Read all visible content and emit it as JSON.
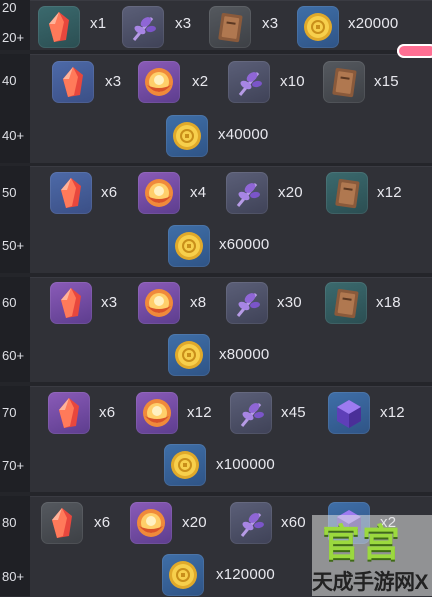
{
  "levels": [
    "20",
    "20+",
    "40",
    "40+",
    "50",
    "50+",
    "60",
    "60+",
    "70",
    "70+",
    "80",
    "80+"
  ],
  "rows": [
    {
      "rewards": [
        "x1",
        "x3",
        "x3",
        "x20000"
      ]
    },
    {
      "rewards": [
        "x3",
        "x2",
        "x10",
        "x15"
      ],
      "gold": "x40000"
    },
    {
      "rewards": [
        "x6",
        "x4",
        "x20",
        "x12"
      ],
      "gold": "x60000"
    },
    {
      "rewards": [
        "x3",
        "x8",
        "x30",
        "x18"
      ],
      "gold": "x80000"
    },
    {
      "rewards": [
        "x6",
        "x12",
        "x45",
        "x12"
      ],
      "gold": "x100000"
    },
    {
      "rewards": [
        "x6",
        "x20",
        "x60",
        "x2"
      ],
      "gold": "x120000"
    }
  ],
  "watermark": {
    "big": "官宫",
    "small": "天成手游网X"
  },
  "icons": {
    "gem": "red-crystal-icon",
    "orb": "flame-orb-icon",
    "herb": "purple-herb-icon",
    "book": "book-icon",
    "coin": "gold-coin-icon",
    "cube": "purple-cube-icon"
  }
}
